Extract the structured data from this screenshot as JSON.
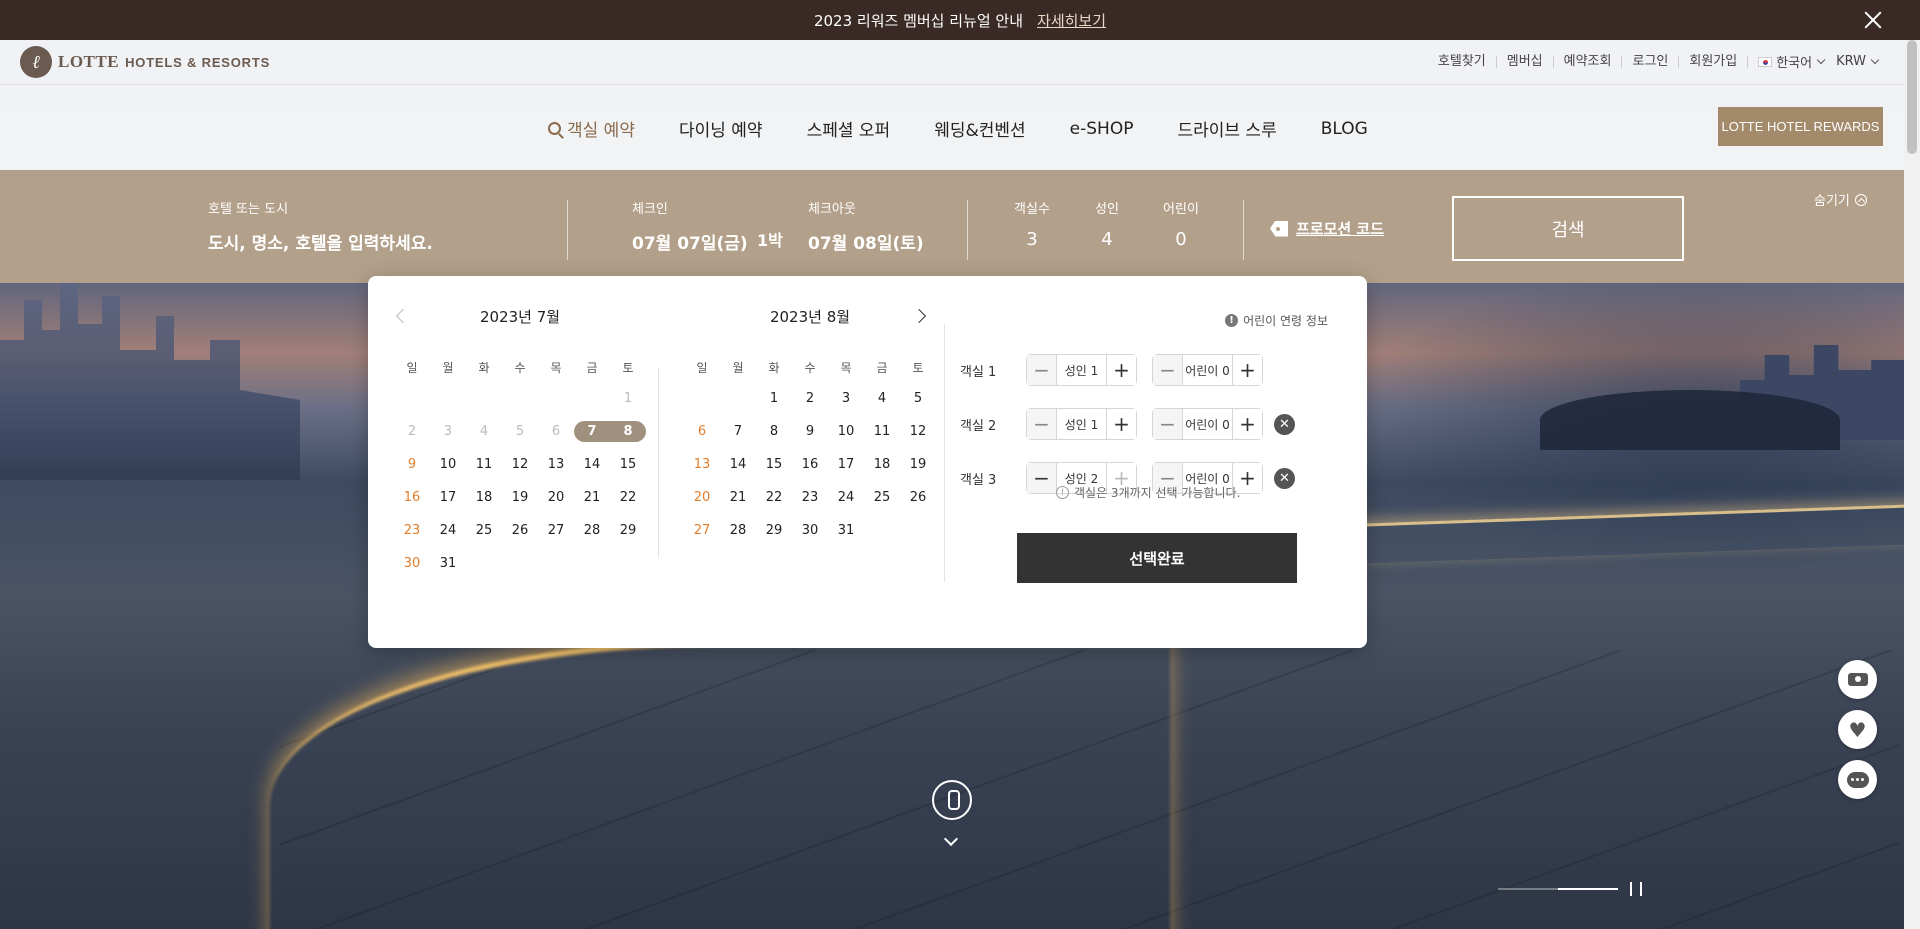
{
  "notice": {
    "text": "2023 리워즈 멤버십 리뉴얼 안내",
    "link": "자세히보기"
  },
  "header": {
    "logo_mark": "ℓ",
    "brand": "LOTTE",
    "brand_sub": "HOTELS & RESORTS",
    "util_links": [
      "호텔찾기",
      "멤버십",
      "예약조회",
      "로그인",
      "회원가입"
    ],
    "language": "한국어",
    "currency": "KRW",
    "nav": [
      "객실 예약",
      "다이닝 예약",
      "스페셜 오퍼",
      "웨딩&컨벤션",
      "e-SHOP",
      "드라이브 스루",
      "BLOG"
    ],
    "rewards_button": "LOTTE HOTEL REWARDS"
  },
  "booking": {
    "destination_label": "호텔 또는 도시",
    "destination_placeholder": "도시, 명소, 호텔을 입력하세요.",
    "checkin_label": "체크인",
    "checkin_value": "07월 07일(금)",
    "nights": "1박",
    "checkout_label": "체크아웃",
    "checkout_value": "07월 08일(토)",
    "rooms_label": "객실수",
    "rooms_value": "3",
    "adults_label": "성인",
    "adults_value": "4",
    "children_label": "어린이",
    "children_value": "0",
    "promo": "프로모션 코드",
    "search": "검색",
    "hide": "숨기기"
  },
  "calendar": {
    "weekdays": [
      "일",
      "월",
      "화",
      "수",
      "목",
      "금",
      "토"
    ],
    "july": {
      "year": "2023년",
      "month": "7월",
      "days": [
        "",
        "",
        "",
        "",
        "",
        "",
        "1",
        "2",
        "3",
        "4",
        "5",
        "6",
        "7",
        "8",
        "9",
        "10",
        "11",
        "12",
        "13",
        "14",
        "15",
        "16",
        "17",
        "18",
        "19",
        "20",
        "21",
        "22",
        "23",
        "24",
        "25",
        "26",
        "27",
        "28",
        "29",
        "30",
        "31"
      ]
    },
    "august": {
      "year": "2023년",
      "month": "8월",
      "days": [
        "",
        "",
        "1",
        "2",
        "3",
        "4",
        "5",
        "6",
        "7",
        "8",
        "9",
        "10",
        "11",
        "12",
        "13",
        "14",
        "15",
        "16",
        "17",
        "18",
        "19",
        "20",
        "21",
        "22",
        "23",
        "24",
        "25",
        "26",
        "27",
        "28",
        "29",
        "30",
        "31"
      ]
    },
    "selected_start": "7",
    "selected_end": "8"
  },
  "rooms_panel": {
    "kid_info": "어린이 연령 정보",
    "rooms": [
      {
        "label": "객실 1",
        "adults": "성인 1",
        "children": "어린이 0"
      },
      {
        "label": "객실 2",
        "adults": "성인 1",
        "children": "어린이 0"
      },
      {
        "label": "객실 3",
        "adults": "성인 2",
        "children": "어린이 0"
      }
    ],
    "note": "객실은 3개까지 선택 가능합니다.",
    "done": "선택완료"
  },
  "slider": {
    "progress": 0.5
  }
}
